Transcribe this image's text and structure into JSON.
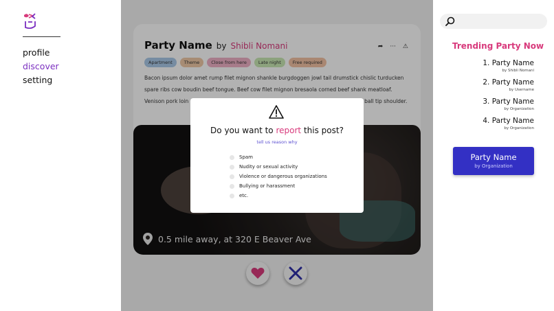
{
  "sidebar": {
    "items": [
      {
        "label": "profile"
      },
      {
        "label": "discover"
      },
      {
        "label": "setting"
      }
    ]
  },
  "post": {
    "party_name": "Party Name",
    "by": "by",
    "author": "Shibli Nomani",
    "tags": [
      {
        "label": "Apartment",
        "color": "#a9c9e8"
      },
      {
        "label": "Theme",
        "color": "#f0c9a6"
      },
      {
        "label": "Close from here",
        "color": "#efb1c6"
      },
      {
        "label": "Late night",
        "color": "#c9e8b4"
      },
      {
        "label": "Free required",
        "color": "#f3c2a4"
      }
    ],
    "description": "Bacon ipsum dolor amet rump filet mignon shankle burgdoggen jowl tail drumstick chislic turducken spare ribs cow boudin beef tongue. Beef cow filet mignon bresaola corned beef shank meatloaf. Venison pork loin prosciutto beef meatball pastrami jerky short loin chicken leberkas ball tip shoulder.",
    "location": "0.5 mile away, at 320 E Beaver Ave"
  },
  "modal": {
    "title_pre": "Do you want to ",
    "title_highlight": "report",
    "title_post": " this post?",
    "subtitle": "tell us reason why",
    "options": [
      "Spam",
      "Nudity or sexual activity",
      "Violence or dangerous organizations",
      "Bullying or harassment",
      "etc."
    ]
  },
  "search": {
    "placeholder": ""
  },
  "trending": {
    "title": "Trending Party Now",
    "items": [
      {
        "name": "1. Party Name",
        "sub": "by Shibli Nomani"
      },
      {
        "name": "2. Party Name",
        "sub": "by Username"
      },
      {
        "name": "3. Party Name",
        "sub": "by Organization"
      },
      {
        "name": "4. Party Name",
        "sub": "by Organization"
      }
    ],
    "featured": {
      "name": "Party Name",
      "sub": "by Organization"
    }
  },
  "colors": {
    "accent_pink": "#d83a7c",
    "accent_purple": "#7b2fc0",
    "featured_blue": "#3330c4"
  },
  "icons": [
    "logo-icon",
    "share-icon",
    "more-icon",
    "flag-icon",
    "location-pin-icon",
    "heart-icon",
    "close-x-icon",
    "warning-icon",
    "search-icon"
  ]
}
